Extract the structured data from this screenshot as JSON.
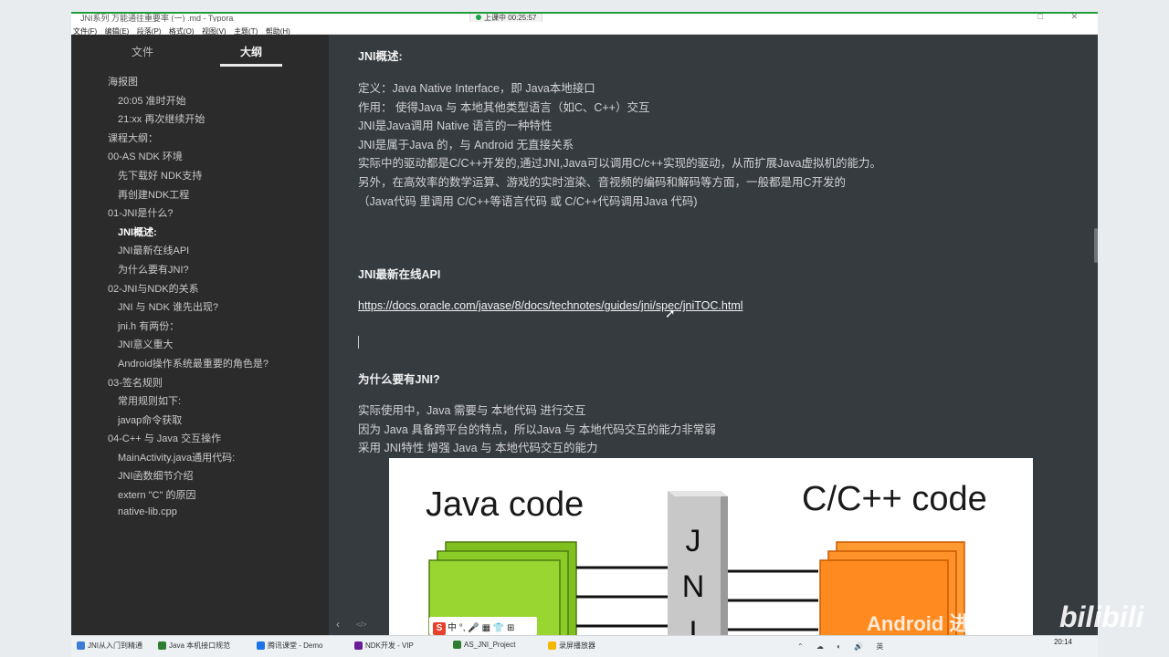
{
  "window": {
    "title": "JNI系列 万能通往重要率 (一) .md - Typora",
    "recording": "上课中 00:25:57",
    "controls": "□ ✕"
  },
  "menubar": [
    "文件(F)",
    "编辑(E)",
    "段落(P)",
    "格式(O)",
    "视图(V)",
    "主题(T)",
    "帮助(H)"
  ],
  "sidebar": {
    "tabs": {
      "files": "文件",
      "outline": "大纲"
    },
    "items": [
      {
        "label": "海报图",
        "level": 1,
        "active": false
      },
      {
        "label": "20:05 准时开始",
        "level": 2,
        "active": false
      },
      {
        "label": "21:xx 再次继续开始",
        "level": 2,
        "active": false
      },
      {
        "label": "课程大纲：",
        "level": 1,
        "active": false
      },
      {
        "label": "00-AS NDK 环境",
        "level": 1,
        "active": false
      },
      {
        "label": "先下载好 NDK支持",
        "level": 2,
        "active": false
      },
      {
        "label": "再创建NDK工程",
        "level": 2,
        "active": false
      },
      {
        "label": "01-JNI是什么?",
        "level": 1,
        "active": false
      },
      {
        "label": "JNI概述:",
        "level": 2,
        "active": true
      },
      {
        "label": "JNI最新在线API",
        "level": 2,
        "active": false
      },
      {
        "label": "为什么要有JNI?",
        "level": 2,
        "active": false
      },
      {
        "label": "02-JNI与NDK的关系",
        "level": 1,
        "active": false
      },
      {
        "label": "JNI 与 NDK 谁先出现?",
        "level": 2,
        "active": false
      },
      {
        "label": "jni.h 有两份：",
        "level": 2,
        "active": false
      },
      {
        "label": "JNI意义重大",
        "level": 2,
        "active": false
      },
      {
        "label": "Android操作系统最重要的角色是?",
        "level": 2,
        "active": false
      },
      {
        "label": "03-签名规则",
        "level": 1,
        "active": false
      },
      {
        "label": "常用规则如下:",
        "level": 2,
        "active": false
      },
      {
        "label": "javap命令获取",
        "level": 2,
        "active": false
      },
      {
        "label": "04-C++ 与 Java 交互操作",
        "level": 1,
        "active": false
      },
      {
        "label": "MainActivity.java通用代码:",
        "level": 2,
        "active": false
      },
      {
        "label": "JNI函数细节介绍",
        "level": 2,
        "active": false
      },
      {
        "label": "extern \"C\" 的原因",
        "level": 2,
        "active": false
      },
      {
        "label": "native-lib.cpp",
        "level": 2,
        "active": false
      }
    ]
  },
  "doc": {
    "h_overview": "JNI概述:",
    "overview_lines": [
      "定义：Java Native Interface，即 Java本地接口",
      "作用： 使得Java 与 本地其他类型语言（如C、C++）交互",
      "JNI是Java调用 Native 语言的一种特性",
      "JNI是属于Java 的，与 Android 无直接关系",
      "实际中的驱动都是C/C++开发的,通过JNI,Java可以调用C/c++实现的驱动，从而扩展Java虚拟机的能力。",
      "另外，在高效率的数学运算、游戏的实时渲染、音视频的编码和解码等方面，一般都是用C开发的",
      "（Java代码 里调用 C/C++等语言代码 或 C/C++代码调用Java 代码)"
    ],
    "h_api": "JNI最新在线API",
    "api_url": "https://docs.oracle.com/javase/8/docs/technotes/guides/jni/spec/jniTOC.html",
    "h_why": "为什么要有JNI?",
    "why_lines": [
      "实际使用中，Java 需要与 本地代码 进行交互",
      "因为 Java 具备跨平台的特点，所以Java 与 本地代码交互的能力非常弱",
      "采用 JNI特性 增强 Java 与 本地代码交互的能力"
    ],
    "diagram": {
      "java_label": "Java code",
      "native_label": "C/C++ code",
      "bridge_letters": [
        "J",
        "N",
        "I"
      ]
    }
  },
  "ime": {
    "badge": "S",
    "items": "中 °, 🎤 ▦ 👕 ⊞"
  },
  "footer": {
    "toggle": "‹",
    "code_toggle": "</>"
  },
  "watermark": {
    "text": "Android 进阶解析",
    "logo": "bilibili"
  },
  "taskbar": {
    "items": [
      {
        "label": "JNI从入门到精通",
        "color": "#3b7bd6"
      },
      {
        "label": "Java 本机接口规范",
        "color": "#2e7d32"
      },
      {
        "label": "腾讯课堂 - Demo",
        "color": "#1a73e8"
      },
      {
        "label": "NDK开发 - VIP",
        "color": "#6a1b9a"
      },
      {
        "label": "AS_JNI_Project",
        "color": "#2e7d32"
      },
      {
        "label": "录屏播放器",
        "color": "#f5b800"
      }
    ],
    "time": "20:14",
    "tray": "⌃ ☁ ◐ 🔊 英"
  },
  "colors": {
    "sidebar_bg": "#2b2b2b",
    "editor_bg": "#363b40",
    "java_blocks": "#99d631",
    "native_blocks": "#ff8a1f"
  }
}
